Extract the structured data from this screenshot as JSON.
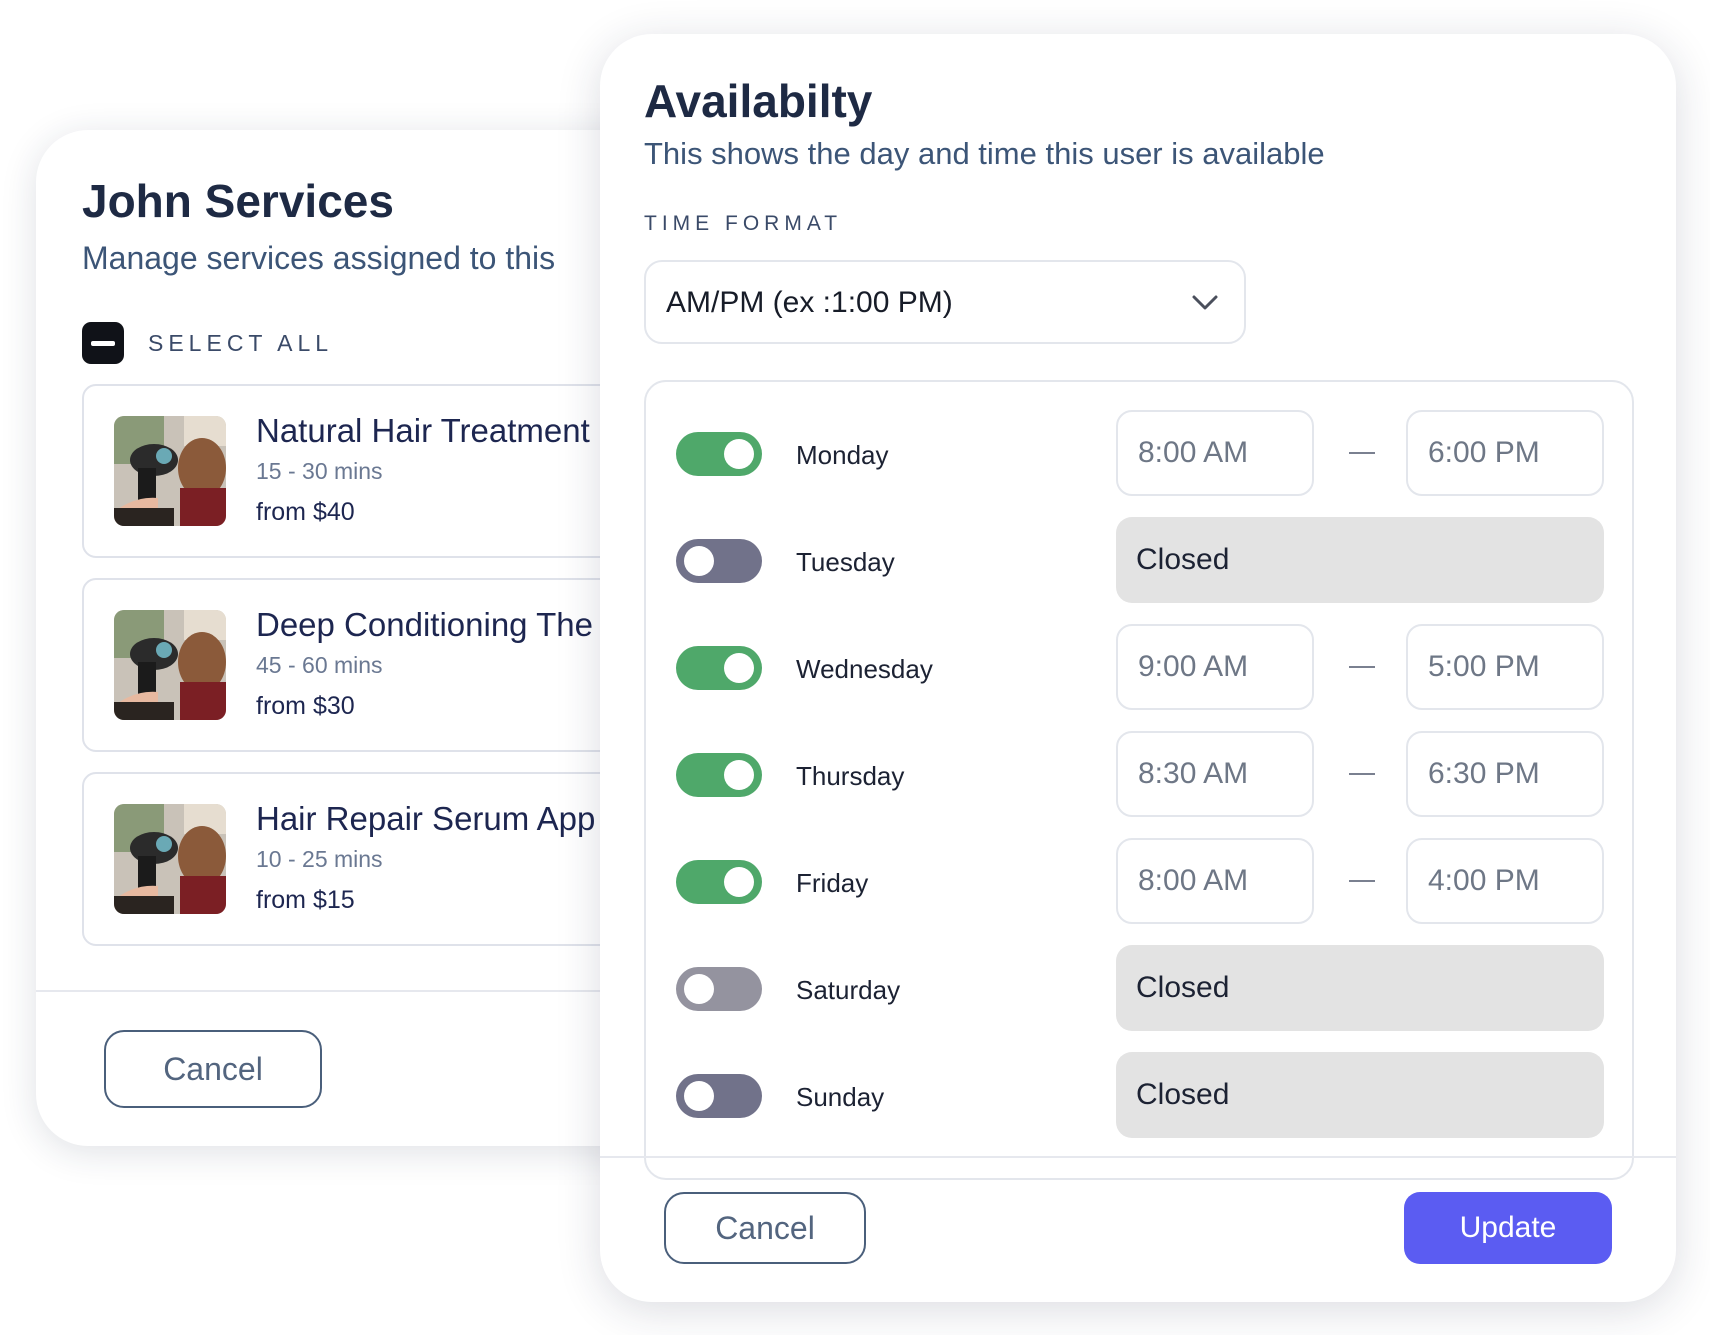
{
  "services_panel": {
    "title": "John Services",
    "subtitle": "Manage services assigned to this",
    "select_all_label": "SELECT ALL",
    "services": [
      {
        "name": "Natural Hair Treatment",
        "duration": "15 - 30 mins",
        "price": "from $40"
      },
      {
        "name": "Deep Conditioning The",
        "duration": "45 - 60 mins",
        "price": "from $30"
      },
      {
        "name": "Hair Repair Serum App",
        "duration": "10 - 25 mins",
        "price": "from $15"
      }
    ],
    "cancel_label": "Cancel"
  },
  "availability_panel": {
    "title": "Availabilty",
    "subtitle": "This shows the day and time this user is available",
    "time_format_label": "TIME FORMAT",
    "time_format_value": "AM/PM (ex :1:00 PM)",
    "days": [
      {
        "name": "Monday",
        "enabled": true,
        "start": "8:00 AM",
        "end": "6:00 PM"
      },
      {
        "name": "Tuesday",
        "enabled": false,
        "status": "Closed"
      },
      {
        "name": "Wednesday",
        "enabled": true,
        "start": "9:00 AM",
        "end": "5:00 PM"
      },
      {
        "name": "Thursday",
        "enabled": true,
        "start": "8:30 AM",
        "end": "6:30 PM"
      },
      {
        "name": "Friday",
        "enabled": true,
        "start": "8:00 AM",
        "end": "4:00 PM"
      },
      {
        "name": "Saturday",
        "enabled": false,
        "status": "Closed"
      },
      {
        "name": "Sunday",
        "enabled": false,
        "status": "Closed"
      }
    ],
    "cancel_label": "Cancel",
    "update_label": "Update"
  },
  "colors": {
    "toggle_on": "#4fa86a",
    "toggle_off": "#71728a",
    "update_button": "#5b5cf2",
    "closed_fill": "#e3e3e3"
  }
}
